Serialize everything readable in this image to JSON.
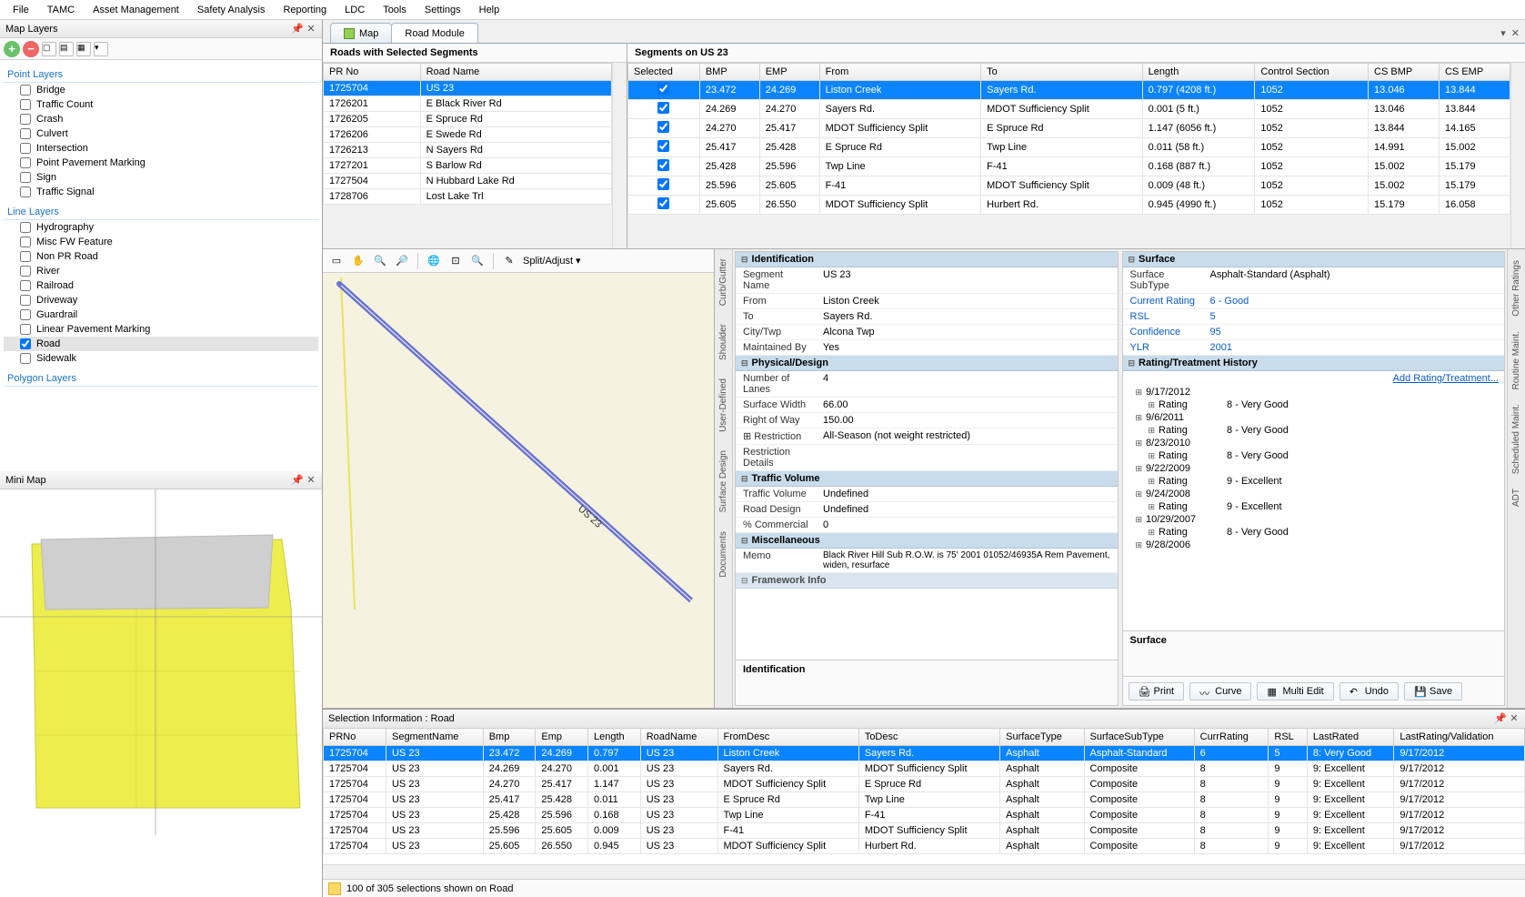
{
  "menubar": [
    "File",
    "TAMC",
    "Asset Management",
    "Safety Analysis",
    "Reporting",
    "LDC",
    "Tools",
    "Settings",
    "Help"
  ],
  "panels": {
    "map_layers_title": "Map Layers",
    "mini_map_title": "Mini Map"
  },
  "layer_groups": {
    "point": {
      "label": "Point Layers",
      "items": [
        "Bridge",
        "Traffic Count",
        "Crash",
        "Culvert",
        "Intersection",
        "Point Pavement Marking",
        "Sign",
        "Traffic Signal"
      ]
    },
    "line": {
      "label": "Line Layers",
      "items": [
        "Hydrography",
        "Misc FW Feature",
        "Non PR Road",
        "River",
        "Railroad",
        "Driveway",
        "Guardrail",
        "Linear Pavement Marking",
        "Road",
        "Sidewalk"
      ],
      "checked": "Road"
    },
    "polygon": {
      "label": "Polygon Layers"
    }
  },
  "tabs": {
    "map": "Map",
    "road": "Road Module"
  },
  "roads_panel": {
    "title": "Roads with Selected Segments",
    "cols": [
      "PR No",
      "Road Name"
    ],
    "rows": [
      {
        "pr": "1725704",
        "name": "US 23",
        "sel": true
      },
      {
        "pr": "1726201",
        "name": "E Black River Rd"
      },
      {
        "pr": "1726205",
        "name": "E Spruce Rd"
      },
      {
        "pr": "1726206",
        "name": "E Swede Rd"
      },
      {
        "pr": "1726213",
        "name": "N Sayers Rd"
      },
      {
        "pr": "1727201",
        "name": "S Barlow Rd"
      },
      {
        "pr": "1727504",
        "name": "N Hubbard Lake Rd"
      },
      {
        "pr": "1728706",
        "name": "Lost Lake Trl"
      }
    ]
  },
  "segments_panel": {
    "title": "Segments on US 23",
    "cols": [
      "Selected",
      "BMP",
      "EMP",
      "From",
      "To",
      "Length",
      "Control Section",
      "CS BMP",
      "CS EMP"
    ],
    "rows": [
      {
        "sel": true,
        "bmp": "23.472",
        "emp": "24.269",
        "from": "Liston Creek",
        "to": "Sayers Rd.",
        "len": "0.797 (4208 ft.)",
        "cs": "1052",
        "csbmp": "13.046",
        "csemp": "13.844",
        "hl": true
      },
      {
        "sel": true,
        "bmp": "24.269",
        "emp": "24.270",
        "from": "Sayers Rd.",
        "to": "MDOT Sufficiency Split",
        "len": "0.001 (5 ft.)",
        "cs": "1052",
        "csbmp": "13.046",
        "csemp": "13.844"
      },
      {
        "sel": true,
        "bmp": "24.270",
        "emp": "25.417",
        "from": "MDOT Sufficiency Split",
        "to": "E Spruce Rd",
        "len": "1.147 (6056 ft.)",
        "cs": "1052",
        "csbmp": "13.844",
        "csemp": "14.165"
      },
      {
        "sel": true,
        "bmp": "25.417",
        "emp": "25.428",
        "from": "E Spruce Rd",
        "to": "Twp Line",
        "len": "0.011 (58 ft.)",
        "cs": "1052",
        "csbmp": "14.991",
        "csemp": "15.002"
      },
      {
        "sel": true,
        "bmp": "25.428",
        "emp": "25.596",
        "from": "Twp Line",
        "to": "F-41",
        "len": "0.168 (887 ft.)",
        "cs": "1052",
        "csbmp": "15.002",
        "csemp": "15.179"
      },
      {
        "sel": true,
        "bmp": "25.596",
        "emp": "25.605",
        "from": "F-41",
        "to": "MDOT Sufficiency Split",
        "len": "0.009 (48 ft.)",
        "cs": "1052",
        "csbmp": "15.002",
        "csemp": "15.179"
      },
      {
        "sel": true,
        "bmp": "25.605",
        "emp": "26.550",
        "from": "MDOT Sufficiency Split",
        "to": "Hurbert Rd.",
        "len": "0.945 (4990 ft.)",
        "cs": "1052",
        "csbmp": "15.179",
        "csemp": "16.058"
      }
    ]
  },
  "map_toolbar": {
    "split_adjust": "Split/Adjust"
  },
  "map_side_tabs": [
    "Curb/Gutter",
    "Shoulder",
    "User-Defined",
    "Surface Design",
    "Documents"
  ],
  "map_label": "US 23",
  "identification": {
    "header": "Identification",
    "rows": [
      {
        "k": "Segment Name",
        "v": "US 23"
      },
      {
        "k": "From",
        "v": "Liston Creek"
      },
      {
        "k": "To",
        "v": "Sayers Rd."
      },
      {
        "k": "City/Twp",
        "v": "Alcona Twp"
      },
      {
        "k": "Maintained By",
        "v": "Yes"
      }
    ],
    "physical_header": "Physical/Design",
    "physical": [
      {
        "k": "Number of Lanes",
        "v": "4"
      },
      {
        "k": "Surface Width",
        "v": "66.00"
      },
      {
        "k": "Right of Way",
        "v": "150.00"
      },
      {
        "k": "Restriction",
        "v": "All-Season (not weight restricted)",
        "exp": true
      },
      {
        "k": "Restriction Details",
        "v": ""
      }
    ],
    "traffic_header": "Traffic Volume",
    "traffic": [
      {
        "k": "Traffic Volume",
        "v": "Undefined"
      },
      {
        "k": "Road Design",
        "v": "Undefined"
      },
      {
        "k": "% Commercial",
        "v": "0"
      }
    ],
    "misc_header": "Miscellaneous",
    "memo_k": "Memo",
    "memo_v": "Black River Hill Sub R.O.W. is 75' 2001 01052/46935A Rem Pavement, widen, resurface",
    "fw_header": "Framework Info",
    "footer": "Identification"
  },
  "surface": {
    "header": "Surface",
    "rows": [
      {
        "k": "Surface SubType",
        "v": "Asphalt-Standard (Asphalt)"
      },
      {
        "k": "Current Rating",
        "v": "6 - Good",
        "link": true
      },
      {
        "k": "RSL",
        "v": "5",
        "link": true
      },
      {
        "k": "Confidence",
        "v": "95",
        "link": true
      },
      {
        "k": "YLR",
        "v": "2001",
        "link": true
      }
    ],
    "history_header": "Rating/Treatment History",
    "add_link": "Add Rating/Treatment...",
    "history": [
      {
        "d": "9/17/2012",
        "r": "8 - Very Good"
      },
      {
        "d": "9/6/2011",
        "r": "8 - Very Good"
      },
      {
        "d": "8/23/2010",
        "r": "8 - Very Good"
      },
      {
        "d": "9/22/2009",
        "r": "9 - Excellent"
      },
      {
        "d": "9/24/2008",
        "r": "9 - Excellent"
      },
      {
        "d": "10/29/2007",
        "r": "8 - Very Good"
      },
      {
        "d": "9/28/2006",
        "r": ""
      }
    ],
    "rating_label": "Rating",
    "footer": "Surface"
  },
  "buttons": {
    "print": "Print",
    "curve": "Curve",
    "multi": "Multi Edit",
    "undo": "Undo",
    "save": "Save"
  },
  "right_vtabs": [
    "Other Ratings",
    "Routine Maint.",
    "Scheduled Maint.",
    "ADT"
  ],
  "sel_info": {
    "title": "Selection Information : Road",
    "cols": [
      "PRNo",
      "SegmentName",
      "Bmp",
      "Emp",
      "Length",
      "RoadName",
      "FromDesc",
      "ToDesc",
      "SurfaceType",
      "SurfaceSubType",
      "CurrRating",
      "RSL",
      "LastRated",
      "LastRating/Validation"
    ],
    "rows": [
      {
        "c": [
          "1725704",
          "US 23",
          "23.472",
          "24.269",
          "0.797",
          "US 23",
          "Liston Creek",
          "Sayers Rd.",
          "Asphalt",
          "Asphalt-Standard",
          "6",
          "5",
          "8: Very Good",
          "9/17/2012"
        ],
        "hl": true
      },
      {
        "c": [
          "1725704",
          "US 23",
          "24.269",
          "24.270",
          "0.001",
          "US 23",
          "Sayers Rd.",
          "MDOT Sufficiency Split",
          "Asphalt",
          "Composite",
          "8",
          "9",
          "9: Excellent",
          "9/17/2012"
        ]
      },
      {
        "c": [
          "1725704",
          "US 23",
          "24.270",
          "25.417",
          "1.147",
          "US 23",
          "MDOT Sufficiency Split",
          "E Spruce Rd",
          "Asphalt",
          "Composite",
          "8",
          "9",
          "9: Excellent",
          "9/17/2012"
        ]
      },
      {
        "c": [
          "1725704",
          "US 23",
          "25.417",
          "25.428",
          "0.011",
          "US 23",
          "E Spruce Rd",
          "Twp Line",
          "Asphalt",
          "Composite",
          "8",
          "9",
          "9: Excellent",
          "9/17/2012"
        ]
      },
      {
        "c": [
          "1725704",
          "US 23",
          "25.428",
          "25.596",
          "0.168",
          "US 23",
          "Twp Line",
          "F-41",
          "Asphalt",
          "Composite",
          "8",
          "9",
          "9: Excellent",
          "9/17/2012"
        ]
      },
      {
        "c": [
          "1725704",
          "US 23",
          "25.596",
          "25.605",
          "0.009",
          "US 23",
          "F-41",
          "MDOT Sufficiency Split",
          "Asphalt",
          "Composite",
          "8",
          "9",
          "9: Excellent",
          "9/17/2012"
        ]
      },
      {
        "c": [
          "1725704",
          "US 23",
          "25.605",
          "26.550",
          "0.945",
          "US 23",
          "MDOT Sufficiency Split",
          "Hurbert Rd.",
          "Asphalt",
          "Composite",
          "8",
          "9",
          "9: Excellent",
          "9/17/2012"
        ]
      }
    ],
    "status": "100 of 305 selections shown on Road"
  }
}
